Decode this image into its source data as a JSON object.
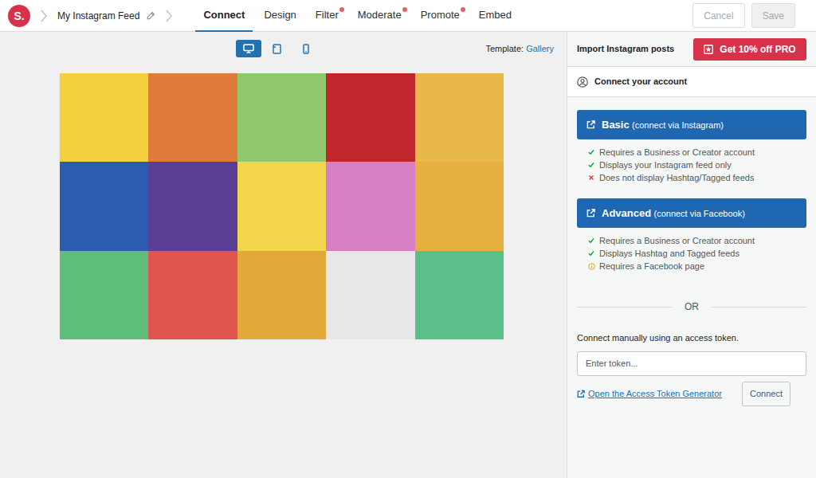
{
  "logo": {
    "text": "S."
  },
  "breadcrumb": {
    "title": "My Instagram Feed"
  },
  "tabs": [
    {
      "label": "Connect",
      "selected": true,
      "dot": false
    },
    {
      "label": "Design",
      "selected": false,
      "dot": false
    },
    {
      "label": "Filter",
      "selected": false,
      "dot": true
    },
    {
      "label": "Moderate",
      "selected": false,
      "dot": true
    },
    {
      "label": "Promote",
      "selected": false,
      "dot": true
    },
    {
      "label": "Embed",
      "selected": false,
      "dot": false
    }
  ],
  "actions": [
    {
      "label": "Cancel",
      "disabled": true
    },
    {
      "label": "Save",
      "disabled": true
    }
  ],
  "devices": [
    {
      "kind": "desktop",
      "selected": true
    },
    {
      "kind": "tablet",
      "selected": false
    },
    {
      "kind": "mobile",
      "selected": false
    }
  ],
  "template": {
    "label": "Template:",
    "value": "Gallery"
  },
  "posts": [
    {
      "color": "#f4d03f"
    },
    {
      "color": "#e07b39"
    },
    {
      "color": "#8fc96b"
    },
    {
      "color": "#c0262c"
    },
    {
      "color": "#e8b84a"
    },
    {
      "color": "#2a5db0"
    },
    {
      "color": "#5b3e96"
    },
    {
      "color": "#f2d54a"
    },
    {
      "color": "#d77fc4"
    },
    {
      "color": "#e8b040"
    },
    {
      "color": "#5fbf7a"
    },
    {
      "color": "#e0564f"
    },
    {
      "color": "#e2a93a"
    },
    {
      "color": "#e8e8e8"
    },
    {
      "color": "#5bbf8a"
    }
  ],
  "panel": {
    "title": "Import Instagram posts",
    "promo": "Get 10% off PRO",
    "section": "Connect your account"
  },
  "options": [
    {
      "label": "Basic",
      "note": "(connect via Instagram)",
      "features": [
        {
          "text": "Requires a Business or Creator account",
          "kind": "check"
        },
        {
          "text": "Displays your Instagram feed only",
          "kind": "check"
        },
        {
          "text": "Does not display Hashtag/Tagged feeds",
          "kind": "cross"
        }
      ]
    },
    {
      "label": "Advanced",
      "note": "(connect via Facebook)",
      "features": [
        {
          "text": "Requires a Business or Creator account",
          "kind": "check"
        },
        {
          "text": "Displays Hashtag and Tagged feeds",
          "kind": "check"
        },
        {
          "text": "Requires a Facebook page",
          "kind": "info"
        }
      ]
    }
  ],
  "divider": "OR",
  "manual": {
    "label": "Connect manually using an access token.",
    "placeholder": "Enter token...",
    "link": "Open the Access Token Generator",
    "button": "Connect"
  }
}
